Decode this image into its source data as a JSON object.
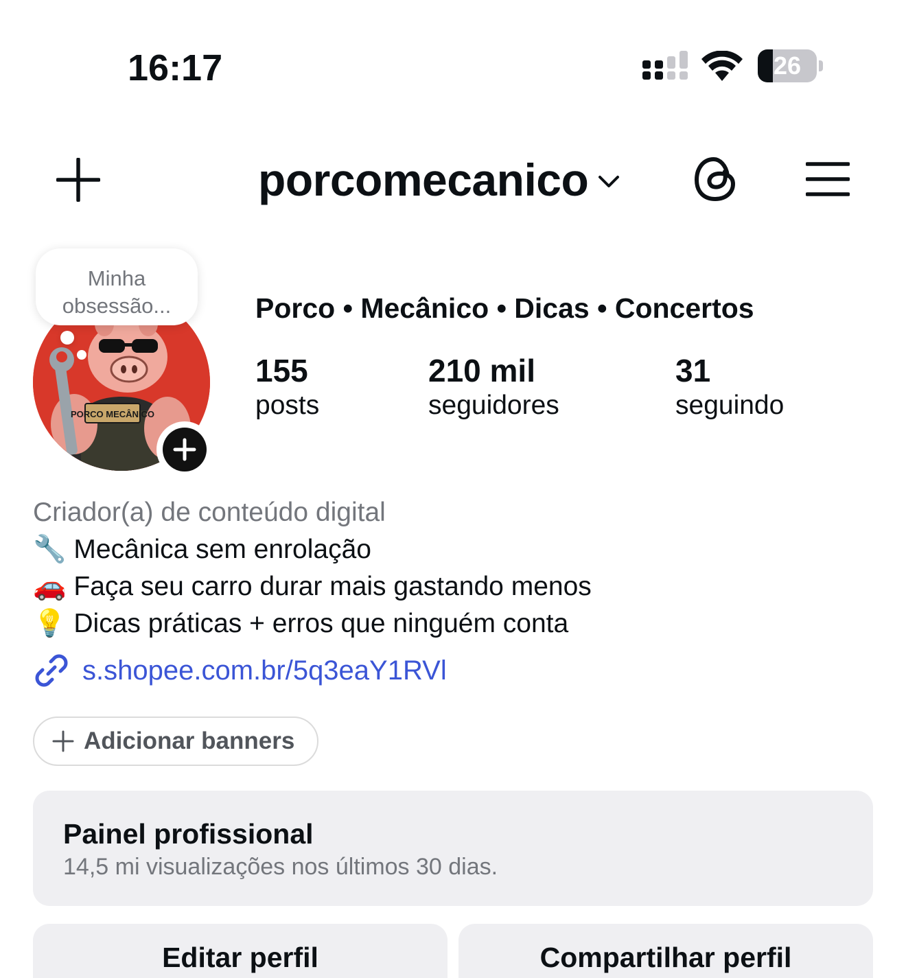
{
  "status_bar": {
    "time": "16:17",
    "battery_level": "26",
    "battery_percent": 26,
    "signal_bars_active": 2,
    "signal_bars_total": 4
  },
  "header": {
    "username": "porcomecanico"
  },
  "profile": {
    "note": "Minha obsessão...",
    "avatar_text": "PORCO MECÂNICO",
    "full_name": "Porco • Mecânico • Dicas • Concertos",
    "stats": [
      {
        "value": "155",
        "label": "posts"
      },
      {
        "value": "210 mil",
        "label": "seguidores"
      },
      {
        "value": "31",
        "label": "seguindo"
      }
    ],
    "category": "Criador(a) de conteúdo digital",
    "bio_lines": [
      "🔧 Mecânica sem enrolação",
      "🚗 Faça seu carro durar mais gastando menos",
      "💡 Dicas práticas + erros que ninguém conta"
    ],
    "link": "s.shopee.com.br/5q3eaY1RVl"
  },
  "banner_button": {
    "label": "Adicionar banners"
  },
  "professional_panel": {
    "title": "Painel profissional",
    "subtitle": "14,5 mi visualizações nos últimos 30 dias."
  },
  "actions": {
    "edit": "Editar perfil",
    "share": "Compartilhar perfil"
  },
  "colors": {
    "link": "#3b55d6",
    "muted": "#73767c",
    "panel_bg": "#efeff2",
    "avatar_bg": "#d8382a"
  },
  "icons": [
    "plus-icon",
    "chevron-down-icon",
    "threads-icon",
    "menu-icon",
    "link-icon",
    "add-story-icon",
    "signal-icon",
    "wifi-icon",
    "battery-icon"
  ]
}
